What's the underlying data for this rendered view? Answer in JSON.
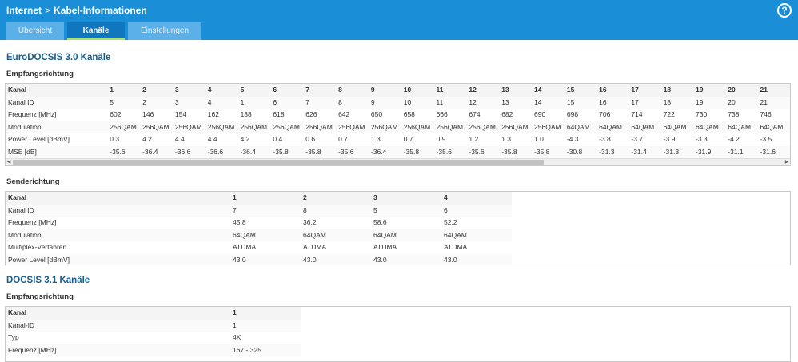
{
  "header": {
    "crumb_root": "Internet",
    "crumb_sep": ">",
    "crumb_page": "Kabel-Informationen",
    "help_label": "?",
    "tabs": [
      {
        "label": "Übersicht",
        "active": false
      },
      {
        "label": "Kanäle",
        "active": true
      },
      {
        "label": "Einstellungen",
        "active": false
      }
    ]
  },
  "docsis30": {
    "title": "EuroDOCSIS 3.0 Kanäle",
    "downstream": {
      "title": "Empfangsrichtung",
      "rows": [
        {
          "label": "Kanal",
          "values": [
            "1",
            "2",
            "3",
            "4",
            "5",
            "6",
            "7",
            "8",
            "9",
            "10",
            "11",
            "12",
            "13",
            "14",
            "15",
            "16",
            "17",
            "18",
            "19",
            "20",
            "21"
          ]
        },
        {
          "label": "Kanal ID",
          "values": [
            "5",
            "2",
            "3",
            "4",
            "1",
            "6",
            "7",
            "8",
            "9",
            "10",
            "11",
            "12",
            "13",
            "14",
            "15",
            "16",
            "17",
            "18",
            "19",
            "20",
            "21"
          ]
        },
        {
          "label": "Frequenz [MHz]",
          "values": [
            "602",
            "146",
            "154",
            "162",
            "138",
            "618",
            "626",
            "642",
            "650",
            "658",
            "666",
            "674",
            "682",
            "690",
            "698",
            "706",
            "714",
            "722",
            "730",
            "738",
            "746"
          ]
        },
        {
          "label": "Modulation",
          "values": [
            "256QAM",
            "256QAM",
            "256QAM",
            "256QAM",
            "256QAM",
            "256QAM",
            "256QAM",
            "256QAM",
            "256QAM",
            "256QAM",
            "256QAM",
            "256QAM",
            "256QAM",
            "256QAM",
            "64QAM",
            "64QAM",
            "64QAM",
            "64QAM",
            "64QAM",
            "64QAM",
            "64QAM"
          ]
        },
        {
          "label": "Power Level [dBmV]",
          "values": [
            "0.3",
            "4.2",
            "4.4",
            "4.4",
            "4.2",
            "0.4",
            "0.6",
            "0.7",
            "1.3",
            "0.7",
            "0.9",
            "1.2",
            "1.3",
            "1.0",
            "-4.3",
            "-3.8",
            "-3.7",
            "-3.9",
            "-3.3",
            "-4.2",
            "-3.5"
          ]
        },
        {
          "label": "MSE [dB]",
          "values": [
            "-35.6",
            "-36.4",
            "-36.6",
            "-36.6",
            "-36.4",
            "-35.8",
            "-35.8",
            "-35.6",
            "-36.4",
            "-35.8",
            "-35.6",
            "-35.6",
            "-35.8",
            "-35.8",
            "-30.8",
            "-31.3",
            "-31.4",
            "-31.3",
            "-31.9",
            "-31.1",
            "-31.6"
          ]
        }
      ]
    },
    "upstream": {
      "title": "Senderichtung",
      "rows": [
        {
          "label": "Kanal",
          "values": [
            "1",
            "2",
            "3",
            "4"
          ]
        },
        {
          "label": "Kanal ID",
          "values": [
            "7",
            "8",
            "5",
            "6"
          ]
        },
        {
          "label": "Frequenz [MHz]",
          "values": [
            "45.8",
            "36.2",
            "58.6",
            "52.2"
          ]
        },
        {
          "label": "Modulation",
          "values": [
            "64QAM",
            "64QAM",
            "64QAM",
            "64QAM"
          ]
        },
        {
          "label": "Multiplex-Verfahren",
          "values": [
            "ATDMA",
            "ATDMA",
            "ATDMA",
            "ATDMA"
          ]
        },
        {
          "label": "Power Level [dBmV]",
          "values": [
            "43.0",
            "43.0",
            "43.0",
            "43.0"
          ]
        }
      ]
    }
  },
  "docsis31": {
    "title": "DOCSIS 3.1 Kanäle",
    "downstream": {
      "title": "Empfangsrichtung",
      "rows": [
        {
          "label": "Kanal",
          "values": [
            "1"
          ]
        },
        {
          "label": "Kanal-ID",
          "values": [
            "1"
          ]
        },
        {
          "label": "Typ",
          "values": [
            "4K"
          ]
        },
        {
          "label": "Frequenz [MHz]",
          "values": [
            "167 - 325"
          ]
        }
      ]
    }
  }
}
